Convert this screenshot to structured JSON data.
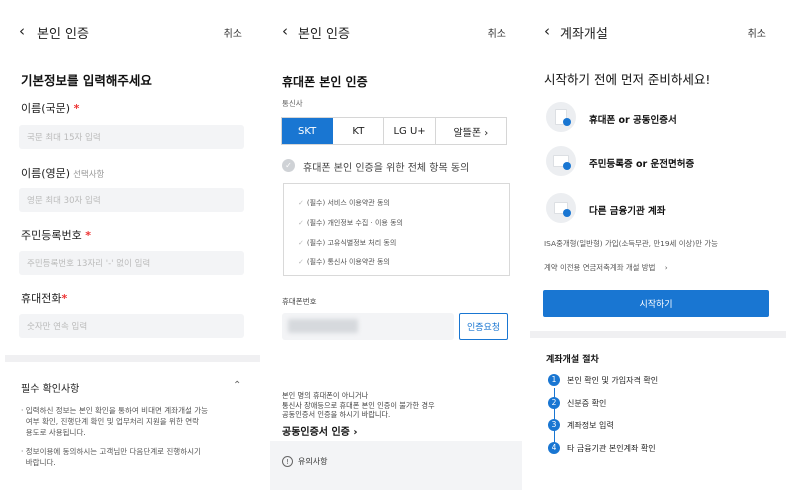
{
  "panel1": {
    "header": {
      "back": "‹",
      "title": "본인 인증",
      "cancel": "취소"
    },
    "heading": "기본정보를 입력해주세요",
    "name_ko": {
      "label": "이름(국문)",
      "req": "*",
      "placeholder": "국문 최대 15자 입력"
    },
    "name_en": {
      "label": "이름(영문)",
      "sub": "선택사항",
      "placeholder": "영문 최대 30자 입력"
    },
    "rrn": {
      "label": "주민등록번호",
      "req": "*",
      "placeholder": "주민등록번호 13자리 '-' 없이 입력"
    },
    "phone": {
      "label": "휴대전화",
      "req": "*",
      "placeholder": "숫자만 연속 입력"
    },
    "notice": {
      "title": "필수 확인사항",
      "toggle": "⌃",
      "items": [
        "· 입력하신 정보는 본인 확인을 통하여 비대면 계좌개설 가능\n  여부 확인, 진행단계 확인 및 업무처리 지원을 위한 연락\n  용도로 사용됩니다.",
        "· 정보이용에 동의하시는 고객님만 다음단계로 진행하시기\n  바랍니다."
      ]
    }
  },
  "panel2": {
    "header": {
      "back": "‹",
      "title": "본인 인증",
      "cancel": "취소"
    },
    "heading": "휴대폰 본인 인증",
    "carrier_label": "통신사",
    "carriers": [
      "SKT",
      "KT",
      "LG U+",
      "알뜰폰  ›"
    ],
    "agree_all": "휴대폰 본인 인증을 위한 전체 항목 동의",
    "agree_items": [
      "(필수) 서비스 이용약관 동의",
      "(필수) 개인정보 수집 · 이용 동의",
      "(필수) 고유식별정보 처리 동의",
      "(필수) 통신사 이용약관 동의"
    ],
    "phone_label": "휴대폰번호",
    "request_button": "인증요청",
    "footnote": "본인 명의 휴대폰이 아니거나\n통신사 장애등으로 휴대폰 본인 인증이 불가한 경우\n공동인증서 인증을 하시기 바랍니다.",
    "cert_link": "공동인증서 인증  ›",
    "caution_icon": "!",
    "caution": "유의사항"
  },
  "panel3": {
    "header": {
      "back": "‹",
      "title": "계좌개설",
      "cancel": "취소"
    },
    "heading": "시작하기 전에 먼저 준비하세요!",
    "items": [
      "휴대폰 or 공동인증서",
      "주민등록증 or 운전면허증",
      "다른 금융기관 계좌"
    ],
    "isa_note": "ISA중개형(일반형) 가입(소득무관, 만19세 이상)만 가능",
    "transfer_link": "계약 이전용 연금저축계좌 개설 방법    ›",
    "start_button": "시작하기",
    "steps_title": "계좌개설 절차",
    "steps": [
      {
        "num": "1",
        "text": "본인 확인 및 가입자격 확인"
      },
      {
        "num": "2",
        "text": "신분증 확인"
      },
      {
        "num": "3",
        "text": "계좌정보 입력"
      },
      {
        "num": "4",
        "text": "타 금융기관 본인계좌 확인"
      }
    ],
    "accent": "#1976d2"
  }
}
